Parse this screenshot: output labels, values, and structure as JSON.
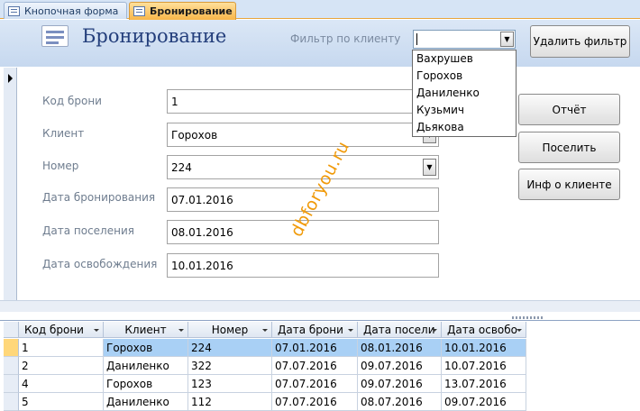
{
  "tabs": [
    {
      "label": "Кнопочная форма",
      "active": false
    },
    {
      "label": "Бронирование",
      "active": true
    }
  ],
  "header": {
    "title": "Бронирование",
    "filter_label": "Фильтр по клиенту",
    "filter_value": "",
    "remove_filter_label": "Удалить фильтр"
  },
  "dropdown": {
    "options": [
      "Вахрушев",
      "Горохов",
      "Даниленко",
      "Кузьмич",
      "Дьякова"
    ]
  },
  "form": {
    "booking_code_label": "Код брони",
    "booking_code_value": "1",
    "client_label": "Клиент",
    "client_value": "Горохов",
    "room_label": "Номер",
    "room_value": "224",
    "booking_date_label": "Дата бронирования",
    "booking_date_value": "07.01.2016",
    "checkin_date_label": "Дата поселения",
    "checkin_date_value": "08.01.2016",
    "checkout_date_label": "Дата освобождения",
    "checkout_date_value": "10.01.2016"
  },
  "buttons": {
    "report": "Отчёт",
    "settle": "Поселить",
    "client_info": "Инф о клиенте"
  },
  "watermark": "dbforyou.ru",
  "table": {
    "columns": [
      "Код брони",
      "Клиент",
      "Номер",
      "Дата брони",
      "Дата посели",
      "Дата освобо"
    ],
    "rows": [
      [
        "1",
        "Горохов",
        "224",
        "07.01.2016",
        "08.01.2016",
        "10.01.2016"
      ],
      [
        "2",
        "Даниленко",
        "322",
        "07.07.2016",
        "09.07.2016",
        "10.07.2016"
      ],
      [
        "4",
        "Горохов",
        "123",
        "07.07.2016",
        "09.07.2016",
        "13.07.2016"
      ],
      [
        "5",
        "Даниленко",
        "112",
        "07.07.2016",
        "08.07.2016",
        "09.07.2016"
      ]
    ],
    "selected_row": 0
  },
  "colors": {
    "header_bg": "#c6d8ef",
    "title": "#233e7b",
    "active_tab": "#f8b64a",
    "selected_row": "#a9d0f5",
    "watermark": "#f09a0a"
  }
}
